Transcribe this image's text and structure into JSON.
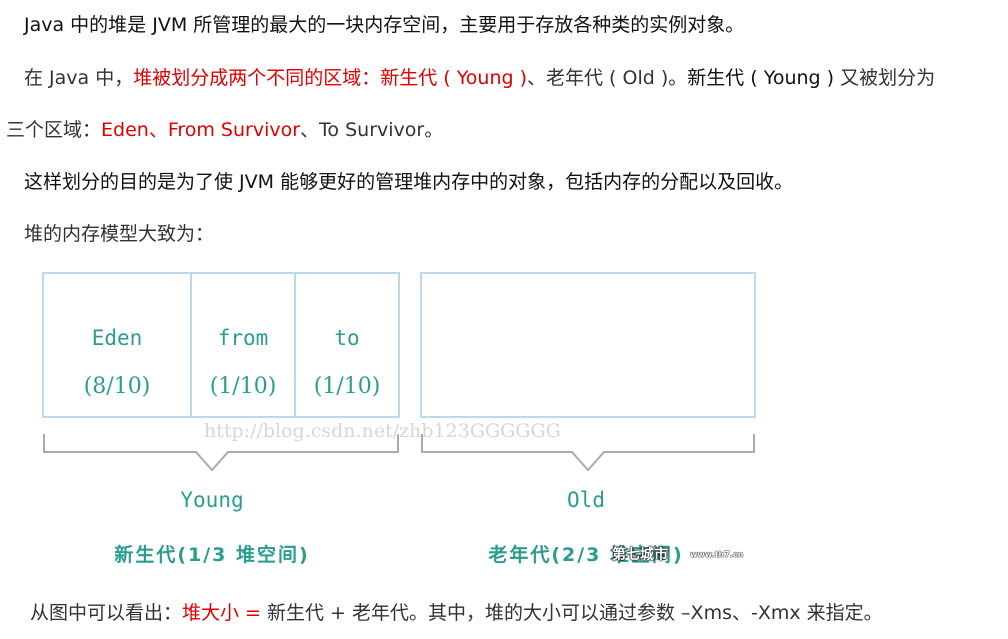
{
  "paragraphs": {
    "p1": {
      "a": "Java 中的堆是 JVM 所管理的最大的一块内存空间，主要用于存放各种类的实例对象。"
    },
    "p2": {
      "a": "在 Java 中，",
      "b": "堆被划分成两个不同的区域：新生代 ( Young )",
      "c": "、老年代 ( Old )。",
      "d": "新生代 ( Young )",
      "e": " 又被划分为"
    },
    "p3": {
      "a": "三个区域：",
      "b": "Eden、From Survivor",
      "c": "、To Survivor。"
    },
    "p4": {
      "a": "这样划分的目的是为了使 JVM 能够更好的管理堆内存中的对象，包括内存的分配以及回收。"
    },
    "p5": {
      "a": "堆的内存模型大致为："
    },
    "p6": {
      "a": "从图中可以看出：",
      "b": "堆大小 = ",
      "c": "新生代 + 老年代。其中，堆的大小可以通过参数 –Xms、-Xmx 来指定。"
    }
  },
  "diagram": {
    "cells": [
      {
        "name": "Eden",
        "ratio": "(8/10)"
      },
      {
        "name": "from",
        "ratio": "(1/10)"
      },
      {
        "name": "to",
        "ratio": "(1/10)"
      }
    ],
    "young_label": "Young",
    "young_sub": "新生代(1/3 堆空间)",
    "old_label": "Old",
    "old_sub": "老年代(2/3 堆空间)",
    "watermark": "http://blog.csdn.net/zhb123GGGGGG",
    "logo_text": "第七城市",
    "logo_domain": "www.th7.cn"
  },
  "colors": {
    "text": "#333333",
    "highlight": "#e00000",
    "diagram_teal": "#2a9d8f",
    "box_border": "#bcd9ec",
    "brace": "#aaaaaa"
  }
}
